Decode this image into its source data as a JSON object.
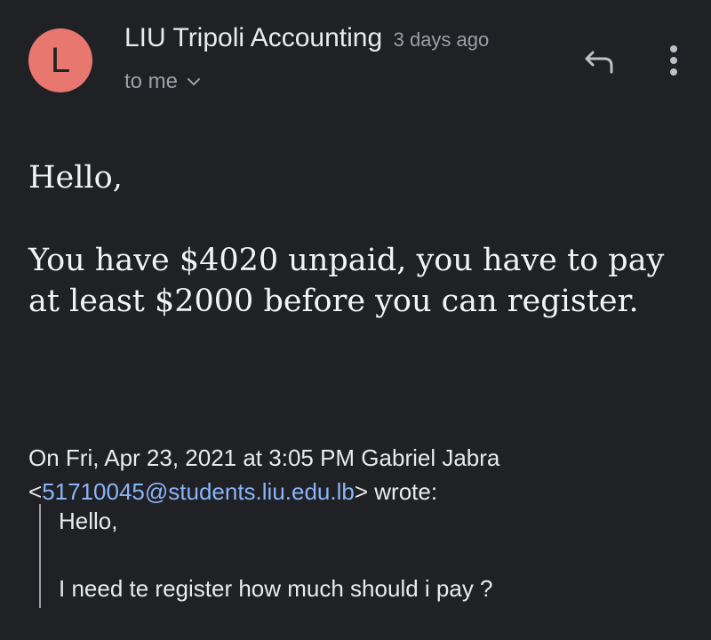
{
  "email": {
    "avatar_letter": "L",
    "avatar_color": "#e8776f",
    "sender_name": "LIU Tripoli Accounting",
    "time_ago": "3 days ago",
    "recipient": "to me",
    "icons": {
      "reply": "reply-icon",
      "more": "more-vertical-icon",
      "expand": "chevron-down-icon"
    },
    "body": {
      "greeting": "Hello,",
      "message": "You have $4020 unpaid, you have to pay at least $2000 before you can register."
    },
    "quote": {
      "intro": "On Fri, Apr 23, 2021 at 3:05 PM Gabriel Jabra",
      "open_bracket": "<",
      "email": "51710045@students.liu.edu.lb",
      "close": "> wrote:",
      "greeting": "Hello,",
      "message": "I need te register how much should i pay ?"
    }
  },
  "colors": {
    "background": "#202124",
    "text": "#e8eaed",
    "muted": "#9aa0a6",
    "link": "#8ab4f8"
  }
}
